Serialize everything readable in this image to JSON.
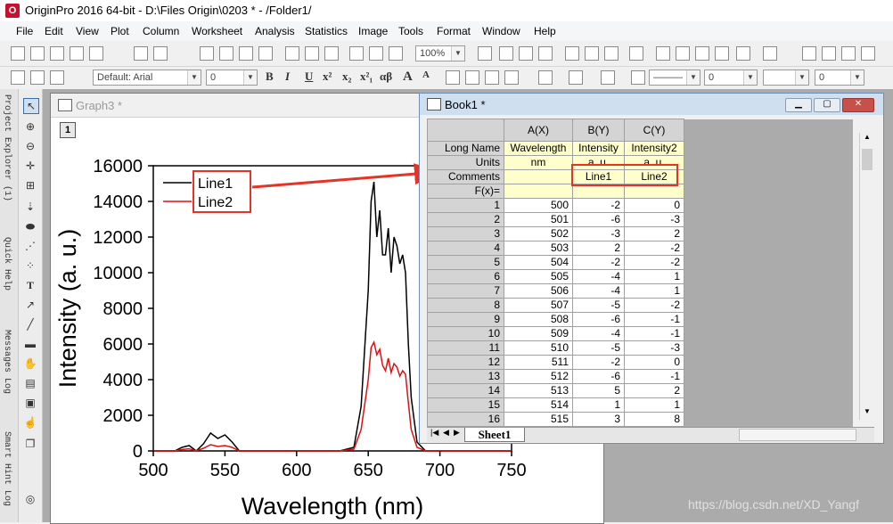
{
  "window": {
    "title": "OriginPro 2016 64-bit - D:\\Files Origin\\0203 * - /Folder1/",
    "logo_text": "O"
  },
  "menu": [
    "File",
    "Edit",
    "View",
    "Plot",
    "Column",
    "Worksheet",
    "Analysis",
    "Statistics",
    "Image",
    "Tools",
    "Format",
    "Window",
    "Help"
  ],
  "toolbar": {
    "zoom": "100%",
    "font": "Default: Arial",
    "size": "0",
    "size2": "0",
    "size3": "0",
    "fmt_buttons": [
      "B",
      "I",
      "U",
      "x²",
      "x₂",
      "x²₁",
      "αβ",
      "A",
      "A"
    ]
  },
  "side_tabs": [
    "Project Explorer (1)",
    "Quick Help",
    "Messages Log",
    "Smart Hint Log"
  ],
  "graph": {
    "window_title": "Graph3 *",
    "layer": "1",
    "chart_data": {
      "type": "line",
      "xlabel": "Wavelength (nm)",
      "ylabel": "Intensity (a. u.)",
      "xlim": [
        500,
        750
      ],
      "ylim": [
        0,
        16000
      ],
      "xticks": [
        500,
        550,
        600,
        650,
        700,
        750
      ],
      "yticks": [
        0,
        2000,
        4000,
        6000,
        8000,
        10000,
        12000,
        14000,
        16000
      ],
      "legend_position": "top-left",
      "series": [
        {
          "name": "Line1",
          "color": "#000000",
          "x": [
            500,
            515,
            520,
            525,
            530,
            535,
            540,
            545,
            550,
            555,
            560,
            600,
            630,
            640,
            645,
            650,
            652,
            654,
            656,
            658,
            660,
            662,
            664,
            666,
            668,
            670,
            672,
            674,
            676,
            678,
            680,
            684,
            690,
            700,
            750
          ],
          "y": [
            0,
            0,
            200,
            300,
            0,
            400,
            1000,
            700,
            900,
            500,
            0,
            0,
            0,
            200,
            2500,
            9000,
            14000,
            15100,
            12000,
            13500,
            11000,
            11000,
            12500,
            10000,
            12000,
            11500,
            10500,
            11000,
            10000,
            6000,
            3000,
            500,
            0,
            0,
            0
          ]
        },
        {
          "name": "Line2",
          "color": "#e01010",
          "x": [
            500,
            515,
            520,
            525,
            530,
            535,
            540,
            545,
            550,
            555,
            560,
            600,
            630,
            640,
            645,
            650,
            652,
            654,
            656,
            658,
            660,
            662,
            664,
            666,
            668,
            670,
            672,
            674,
            676,
            678,
            680,
            684,
            690,
            700,
            750
          ],
          "y": [
            0,
            0,
            80,
            120,
            0,
            150,
            350,
            250,
            300,
            200,
            0,
            0,
            0,
            100,
            1200,
            4000,
            5800,
            6100,
            5400,
            5700,
            4800,
            4500,
            5200,
            4400,
            4900,
            4700,
            4200,
            4500,
            4300,
            2700,
            1200,
            200,
            0,
            0,
            0
          ]
        }
      ]
    }
  },
  "book": {
    "window_title": "Book1 *",
    "row_labels": [
      "Long Name",
      "Units",
      "Comments",
      "F(x)="
    ],
    "columns": [
      {
        "header": "A(X)",
        "long_name": "Wavelength",
        "units": "nm",
        "comments": "",
        "fx": ""
      },
      {
        "header": "B(Y)",
        "long_name": "Intensity",
        "units": "a. u.",
        "comments": "Line1",
        "fx": ""
      },
      {
        "header": "C(Y)",
        "long_name": "Intensity2",
        "units": "a. u.",
        "comments": "Line2",
        "fx": ""
      }
    ],
    "rows": [
      [
        1,
        500,
        -2,
        0
      ],
      [
        2,
        501,
        -6,
        -3
      ],
      [
        3,
        502,
        -3,
        2
      ],
      [
        4,
        503,
        2,
        -2
      ],
      [
        5,
        504,
        -2,
        -2
      ],
      [
        6,
        505,
        -4,
        1
      ],
      [
        7,
        506,
        -4,
        1
      ],
      [
        8,
        507,
        -5,
        -2
      ],
      [
        9,
        508,
        -6,
        -1
      ],
      [
        10,
        509,
        -4,
        -1
      ],
      [
        11,
        510,
        -5,
        -3
      ],
      [
        12,
        511,
        -2,
        0
      ],
      [
        13,
        512,
        -6,
        -1
      ],
      [
        14,
        513,
        5,
        2
      ],
      [
        15,
        514,
        1,
        1
      ],
      [
        16,
        515,
        3,
        8
      ]
    ],
    "sheet_tab": "Sheet1"
  },
  "watermark": "https://blog.csdn.net/XD_Yangf",
  "accent_red": "#e53325"
}
